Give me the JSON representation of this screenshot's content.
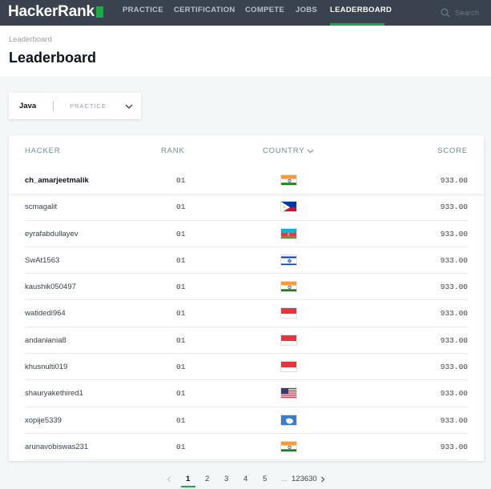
{
  "app": {
    "logo_text": "HackerRank"
  },
  "nav": {
    "items": [
      {
        "label": "PRACTICE"
      },
      {
        "label": "CERTIFICATION"
      },
      {
        "label": "COMPETE"
      },
      {
        "label": "JOBS"
      },
      {
        "label": "LEADERBOARD",
        "active": true
      }
    ],
    "search_placeholder": "Search"
  },
  "header": {
    "breadcrumb": "Leaderboard",
    "title": "Leaderboard"
  },
  "filter": {
    "language": "Java",
    "track": "PRACTICE"
  },
  "table": {
    "columns": {
      "hacker": "HACKER",
      "rank": "RANK",
      "country": "COUNTRY",
      "score": "SCORE"
    },
    "rows": [
      {
        "hacker": "ch_amarjeetmalik",
        "rank": "01",
        "country": "india",
        "score": "933.00"
      },
      {
        "hacker": "scmagalit",
        "rank": "01",
        "country": "philippines",
        "score": "933.00"
      },
      {
        "hacker": "eyrafabdullayev",
        "rank": "01",
        "country": "azerbaijan",
        "score": "933.00"
      },
      {
        "hacker": "SwAt1563",
        "rank": "01",
        "country": "israel",
        "score": "933.00"
      },
      {
        "hacker": "kaushik050497",
        "rank": "01",
        "country": "india",
        "score": "933.00"
      },
      {
        "hacker": "watidedi964",
        "rank": "01",
        "country": "indonesia",
        "score": "933.00"
      },
      {
        "hacker": "andaniania8",
        "rank": "01",
        "country": "indonesia",
        "score": "933.00"
      },
      {
        "hacker": "khusnulti019",
        "rank": "01",
        "country": "indonesia",
        "score": "933.00"
      },
      {
        "hacker": "shauryakethired1",
        "rank": "01",
        "country": "united-states",
        "score": "933.00"
      },
      {
        "hacker": "xopije5339",
        "rank": "01",
        "country": "antarctica",
        "score": "933.00"
      },
      {
        "hacker": "arunavobiswas231",
        "rank": "01",
        "country": "india",
        "score": "933.00"
      }
    ]
  },
  "pagination": {
    "pages": [
      "1",
      "2",
      "3",
      "4",
      "5"
    ],
    "current": "1",
    "ellipsis": "...",
    "last": "123630"
  },
  "colors": {
    "nav_bg": "#39424e",
    "accent": "#1ba94c"
  }
}
